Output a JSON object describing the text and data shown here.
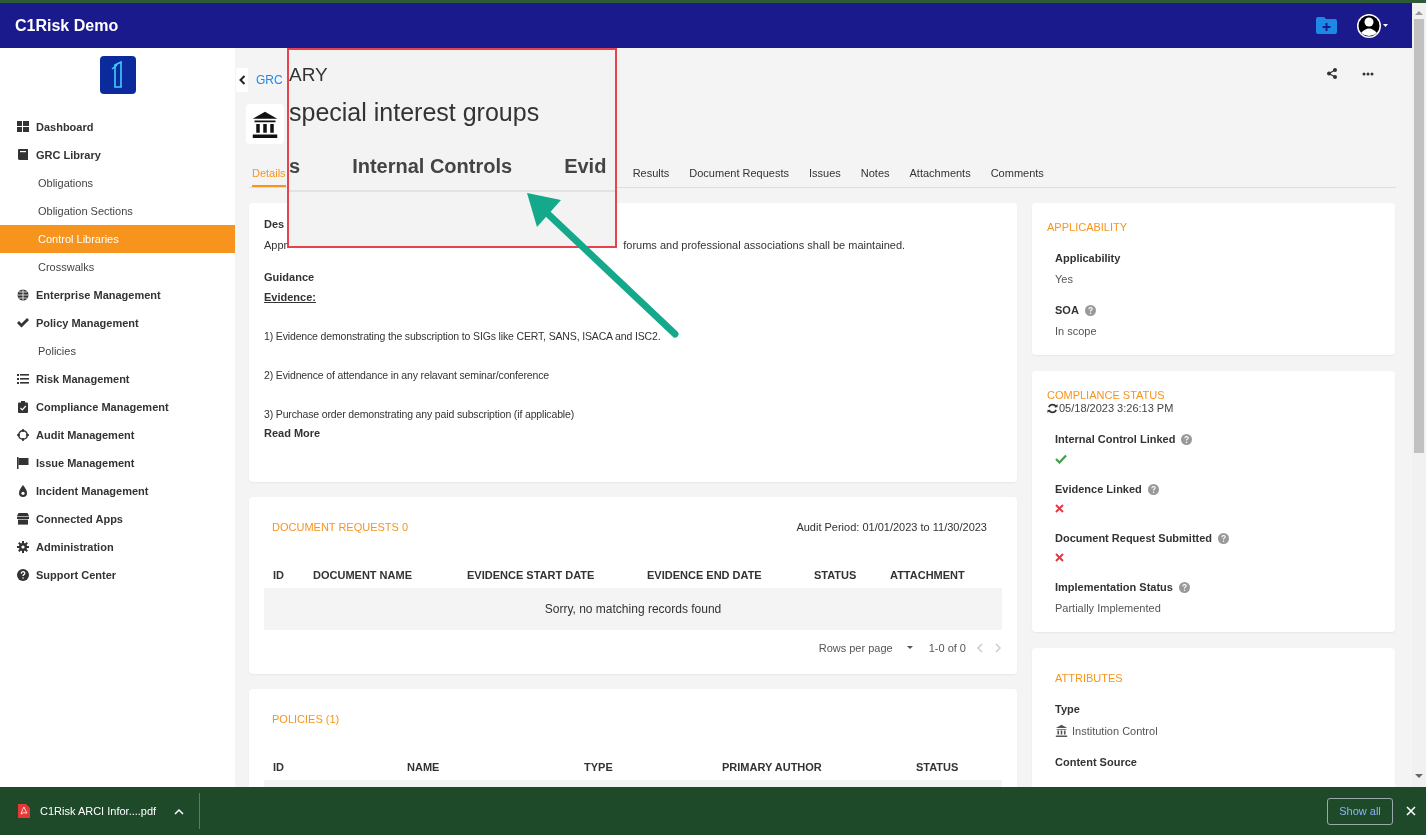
{
  "header": {
    "title": "C1Risk Demo"
  },
  "sidebar": {
    "items": [
      {
        "label": "Dashboard",
        "selected": false
      },
      {
        "label": "GRC Library",
        "selected": false,
        "children": [
          {
            "label": "Obligations",
            "selected": false
          },
          {
            "label": "Obligation Sections",
            "selected": false
          },
          {
            "label": "Control Libraries",
            "selected": true
          },
          {
            "label": "Crosswalks",
            "selected": false
          }
        ]
      },
      {
        "label": "Enterprise Management",
        "selected": false
      },
      {
        "label": "Policy Management",
        "selected": false,
        "children": [
          {
            "label": "Policies",
            "selected": false
          }
        ]
      },
      {
        "label": "Risk Management",
        "selected": false
      },
      {
        "label": "Compliance Management",
        "selected": false
      },
      {
        "label": "Audit Management",
        "selected": false
      },
      {
        "label": "Issue Management",
        "selected": false
      },
      {
        "label": "Incident Management",
        "selected": false
      },
      {
        "label": "Connected Apps",
        "selected": false
      },
      {
        "label": "Administration",
        "selected": false
      },
      {
        "label": "Support Center",
        "selected": false
      }
    ]
  },
  "breadcrumb": "GRC",
  "tabs": [
    {
      "label": "Details",
      "selected": true
    },
    {
      "label": "Results",
      "selected": false
    },
    {
      "label": "Document Requests",
      "selected": false
    },
    {
      "label": "Issues",
      "selected": false
    },
    {
      "label": "Notes",
      "selected": false
    },
    {
      "label": "Attachments",
      "selected": false
    },
    {
      "label": "Comments",
      "selected": false
    }
  ],
  "description": {
    "label": "Des",
    "text_start": "Appr",
    "text_end": "forums and professional associations shall be maintained."
  },
  "guidance": {
    "label": "Guidance",
    "heading": "Evidence:",
    "items": [
      "1) Evidence demonstrating the subscription to SIGs like CERT, SANS, ISACA and ISC2.",
      "2) Evidnence of attendance in any relavant seminar/conference",
      "3) Purchase order demonstrating any paid subscription (if applicable)"
    ],
    "read_more": "Read More"
  },
  "document_requests": {
    "title": "DOCUMENT REQUESTS 0",
    "audit_period": "Audit Period: 01/01/2023 to 11/30/2023",
    "columns": [
      "ID",
      "DOCUMENT NAME",
      "EVIDENCE START DATE",
      "EVIDENCE END DATE",
      "STATUS",
      "ATTACHMENT"
    ],
    "empty_message": "Sorry, no matching records found",
    "rows_per_page": "Rows per page",
    "range": "1-0 of 0"
  },
  "policies": {
    "title": "POLICIES (1)",
    "columns": [
      "ID",
      "NAME",
      "TYPE",
      "PRIMARY AUTHOR",
      "STATUS"
    ]
  },
  "applicability": {
    "title": "APPLICABILITY",
    "fields": [
      {
        "label": "Applicability",
        "help": false,
        "kind": "text",
        "value": "Yes"
      },
      {
        "label": "SOA",
        "help": true,
        "kind": "text",
        "value": "In scope"
      }
    ]
  },
  "compliance_status": {
    "title": "COMPLIANCE STATUS",
    "updated": "05/18/2023 3:26:13 PM",
    "fields": [
      {
        "label": "Internal Control Linked",
        "help": true,
        "kind": "status",
        "ok": true
      },
      {
        "label": "Evidence Linked",
        "help": true,
        "kind": "status",
        "ok": false
      },
      {
        "label": "Document Request Submitted",
        "help": true,
        "kind": "status",
        "ok": false
      },
      {
        "label": "Implementation Status",
        "help": true,
        "kind": "text",
        "value": "Partially Implemented"
      }
    ]
  },
  "attributes": {
    "title": "ATTRIBUTES",
    "fields": [
      {
        "label": "Type",
        "help": false,
        "kind": "icon_text",
        "value": "Institution Control"
      },
      {
        "label": "Content Source",
        "help": false,
        "kind": "none"
      }
    ]
  },
  "callout": {
    "breadcrumb": "ARY",
    "title": "special interest groups",
    "tabs": [
      "s",
      "Internal Controls",
      "Evid"
    ]
  },
  "download_bar": {
    "file": "C1Risk ARCI Infor....pdf",
    "show_all": "Show all"
  }
}
